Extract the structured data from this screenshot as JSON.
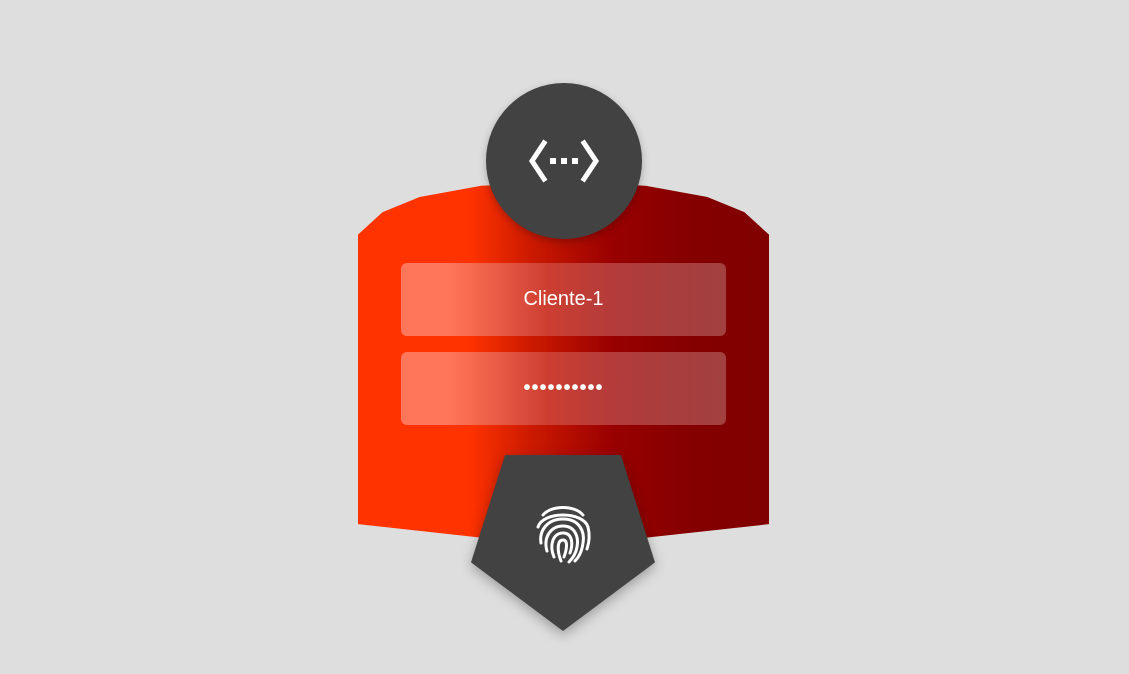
{
  "login": {
    "username": {
      "value": "Cliente-1"
    },
    "password": {
      "value": "••••••••••"
    },
    "icons": {
      "logo": "network-dots-icon",
      "submit": "fingerprint-icon"
    },
    "colors": {
      "background": "#dedede",
      "card_left": "#ff3300",
      "card_right": "#800000",
      "dark": "#424242",
      "text": "#ffffff"
    }
  }
}
